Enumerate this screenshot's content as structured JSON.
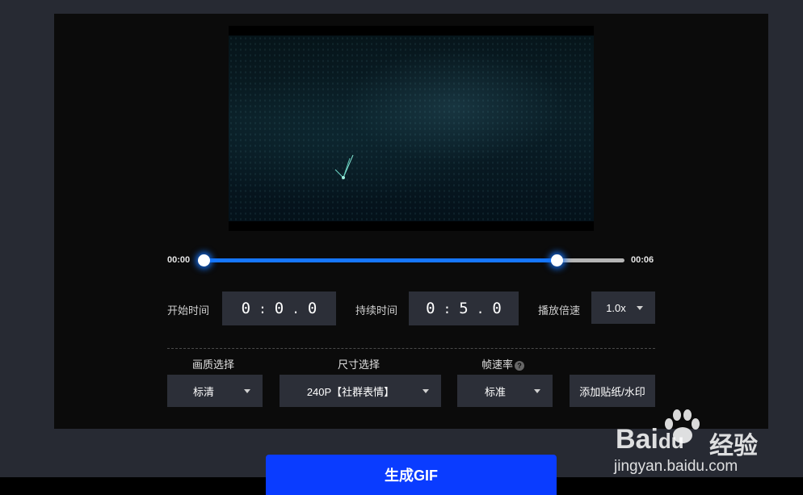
{
  "timeline": {
    "start_label": "00:00",
    "end_label": "00:06",
    "selection_start_fraction": 0.0,
    "selection_end_fraction": 0.84
  },
  "start_time": {
    "label": "开始时间",
    "digits": [
      "0",
      ":",
      "0",
      ".",
      "0"
    ]
  },
  "duration": {
    "label": "持续时间",
    "digits": [
      "0",
      ":",
      "5",
      ".",
      "0"
    ]
  },
  "speed": {
    "label": "播放倍速",
    "value": "1.0x"
  },
  "quality": {
    "label": "画质选择",
    "value": "标清"
  },
  "size": {
    "label": "尺寸选择",
    "value": "240P【社群表情】"
  },
  "framerate": {
    "label": "帧速率",
    "value": "标准",
    "help_icon": "?"
  },
  "sticker_button": "添加贴纸/水印",
  "generate_button": "生成GIF",
  "watermark": {
    "logo": "Bai",
    "logo_suffix": "du",
    "text": "经验",
    "url": "jingyan.baidu.com"
  },
  "colors": {
    "accent": "#1677ff",
    "generate": "#0a3cff",
    "panel": "#0b0b0b",
    "background": "#272a33",
    "control": "#2c2f38"
  }
}
